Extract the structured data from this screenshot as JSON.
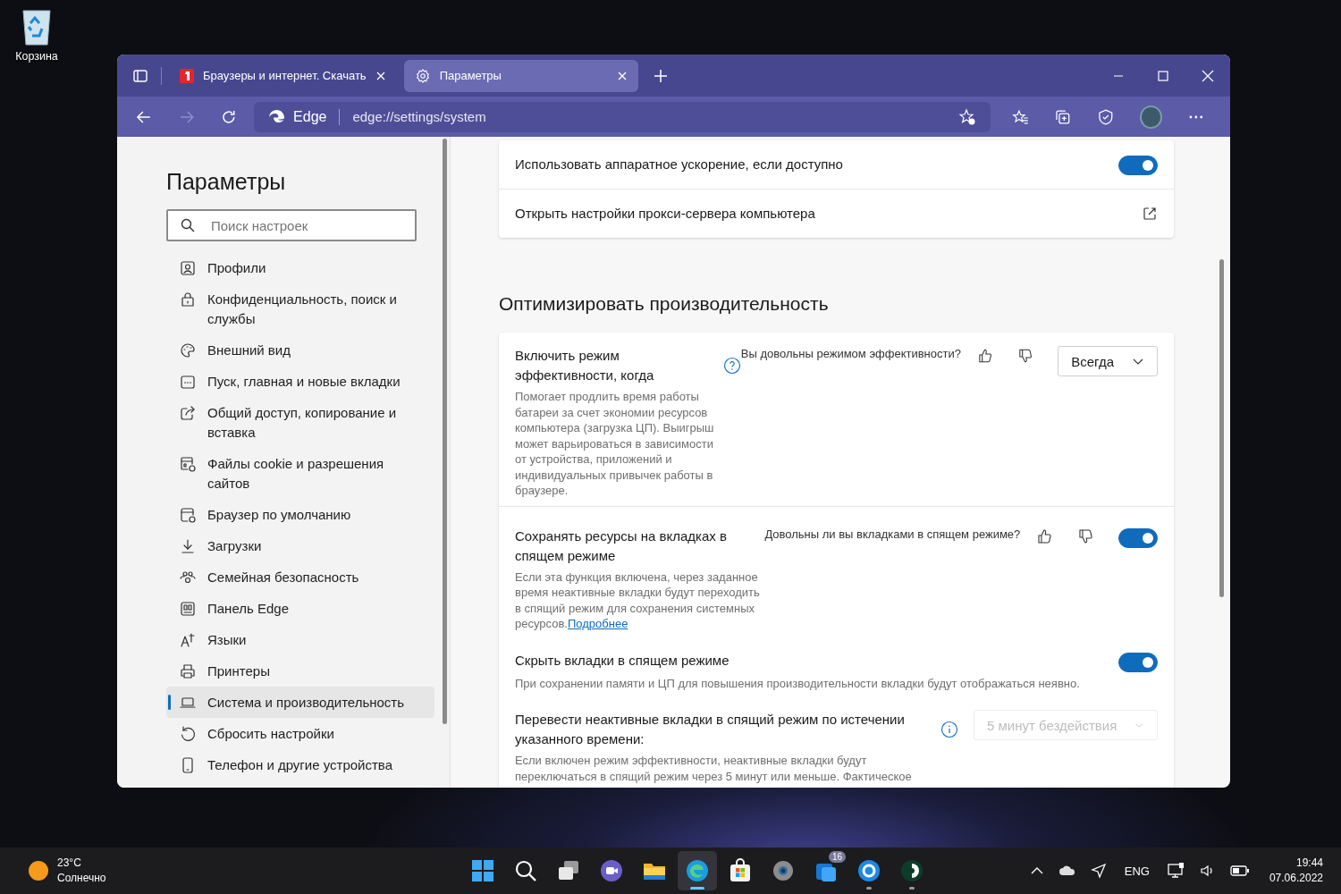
{
  "desktop": {
    "icons": [
      {
        "label": "Корзина"
      }
    ]
  },
  "browser": {
    "tabs": [
      {
        "kind": "site",
        "title": "Браузеры и интернет. Скачать",
        "selected": false
      },
      {
        "kind": "settings",
        "title": "Параметры",
        "selected": true
      }
    ],
    "address": {
      "site": "Edge",
      "url": "edge://settings/system"
    },
    "forward_disabled": true
  },
  "sidebar": {
    "title": "Параметры",
    "search": {
      "placeholder": "Поиск настроек"
    },
    "items": [
      {
        "label": "Профили",
        "selected": false
      },
      {
        "label": "Конфиденциальность, поиск и службы",
        "selected": false
      },
      {
        "label": "Внешний вид",
        "selected": false
      },
      {
        "label": "Пуск, главная и новые вкладки",
        "selected": false
      },
      {
        "label": "Общий доступ, копирование и вставка",
        "selected": false
      },
      {
        "label": "Файлы cookie и разрешения сайтов",
        "selected": false
      },
      {
        "label": "Браузер по умолчанию",
        "selected": false
      },
      {
        "label": "Загрузки",
        "selected": false
      },
      {
        "label": "Семейная безопасность",
        "selected": false
      },
      {
        "label": "Панель Edge",
        "selected": false
      },
      {
        "label": "Языки",
        "selected": false
      },
      {
        "label": "Принтеры",
        "selected": false
      },
      {
        "label": "Система и производительность",
        "selected": true
      },
      {
        "label": "Сбросить настройки",
        "selected": false
      },
      {
        "label": "Телефон и другие устройства",
        "selected": false
      }
    ]
  },
  "content": {
    "top_card": {
      "rows": [
        {
          "kind": "toggle",
          "title": "Использовать аппаратное ускорение, если доступно",
          "on": true,
          "divider": false
        },
        {
          "kind": "link",
          "title": "Открыть настройки прокси-сервера компьютера",
          "divider": true
        }
      ]
    },
    "section": {
      "title": "Оптимизировать производительность",
      "rows": [
        {
          "kind": "select",
          "title": "Включить режим эффективности, когда",
          "help": true,
          "feedback": "Вы довольны режимом эффективности?",
          "value": "Всегда",
          "disabled": false,
          "description": "Помогает продлить время работы батареи за счет экономии ресурсов компьютера (загрузка ЦП). Выигрыш может варьироваться в зависимости от устройства, приложений и индивидуальных привычек работы в браузере.",
          "divider": false
        },
        {
          "kind": "toggle",
          "title": "Сохранять ресурсы на вкладках в спящем режиме",
          "feedback": "Довольны ли вы вкладками в спящем режиме?",
          "on": true,
          "description": "Если эта функция включена, через заданное время неактивные вкладки будут переходить в спящий режим для сохранения системных ресурсов.",
          "link": "Подробнее",
          "divider": true
        },
        {
          "kind": "toggle",
          "title": "Скрыть вкладки в спящем режиме",
          "on": true,
          "description": "При сохранении памяти и ЦП для повышения производительности вкладки будут отображаться неявно.",
          "divider": false
        },
        {
          "kind": "select",
          "title": "Перевести неактивные вкладки в спящий режим по истечении указанного времени:",
          "help": true,
          "value": "5 минут бездействия",
          "disabled": true,
          "description": "Если включен режим эффективности, неактивные вкладки будут переключаться в спящий режим через 5 минут или меньше. Фактическое",
          "divider": false
        }
      ]
    }
  },
  "taskbar": {
    "weather": {
      "temp": "23°C",
      "condition": "Солнечно"
    },
    "apps": [
      {
        "kind": "start",
        "active": false,
        "running": false
      },
      {
        "kind": "search",
        "active": false,
        "running": false
      },
      {
        "kind": "taskview",
        "active": false,
        "running": false
      },
      {
        "kind": "chat",
        "active": false,
        "running": false
      },
      {
        "kind": "folder",
        "active": false,
        "running": false
      },
      {
        "kind": "edge",
        "active": true,
        "running": true
      },
      {
        "kind": "store",
        "active": false,
        "running": false
      },
      {
        "kind": "gear",
        "active": false,
        "running": false
      },
      {
        "kind": "tasks",
        "active": false,
        "running": false,
        "badge": "16"
      },
      {
        "kind": "bluering",
        "active": false,
        "running": true
      },
      {
        "kind": "greenapp",
        "active": false,
        "running": true
      }
    ],
    "tray": {
      "language": "ENG",
      "time": "19:44",
      "date": "07.06.2022"
    }
  }
}
